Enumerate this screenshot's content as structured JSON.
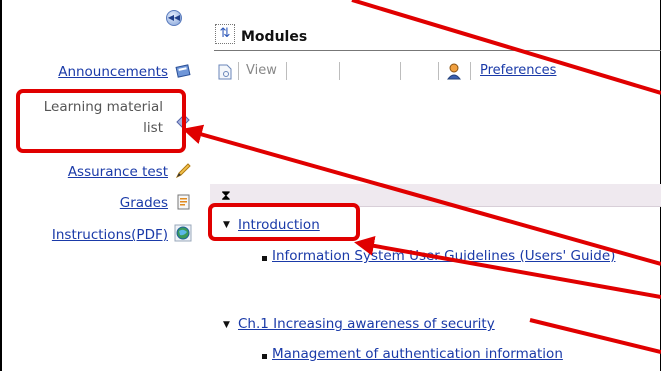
{
  "sidebar": {
    "collapse_icon": "double-chevron-left-icon",
    "items": [
      {
        "label": "Announcements",
        "icon": "pinned-note-icon"
      },
      {
        "label_line1": "Learning material",
        "label_line2": "list",
        "icon": "eraser-icon"
      },
      {
        "label": "Assurance test",
        "icon": "pencil-icon"
      },
      {
        "label": "Grades",
        "icon": "report-icon"
      },
      {
        "label": "Instructions(PDF)",
        "icon": "globe-icon"
      }
    ]
  },
  "header": {
    "title": "Modules",
    "title_icon": "swap-arrows-icon"
  },
  "toolbar": {
    "view_label": "View",
    "preferences_label": "Preferences",
    "page_icon": "page-icon",
    "person_icon": "person-icon"
  },
  "content": {
    "band_icon": "hourglass-icon",
    "sections": [
      {
        "title": "Introduction",
        "items": [
          "Information System User Guidelines (Users' Guide)"
        ]
      },
      {
        "title": "Ch.1 Increasing awareness of security",
        "items": [
          "Management of authentication information"
        ]
      }
    ]
  },
  "annotation_color": "#e00000"
}
